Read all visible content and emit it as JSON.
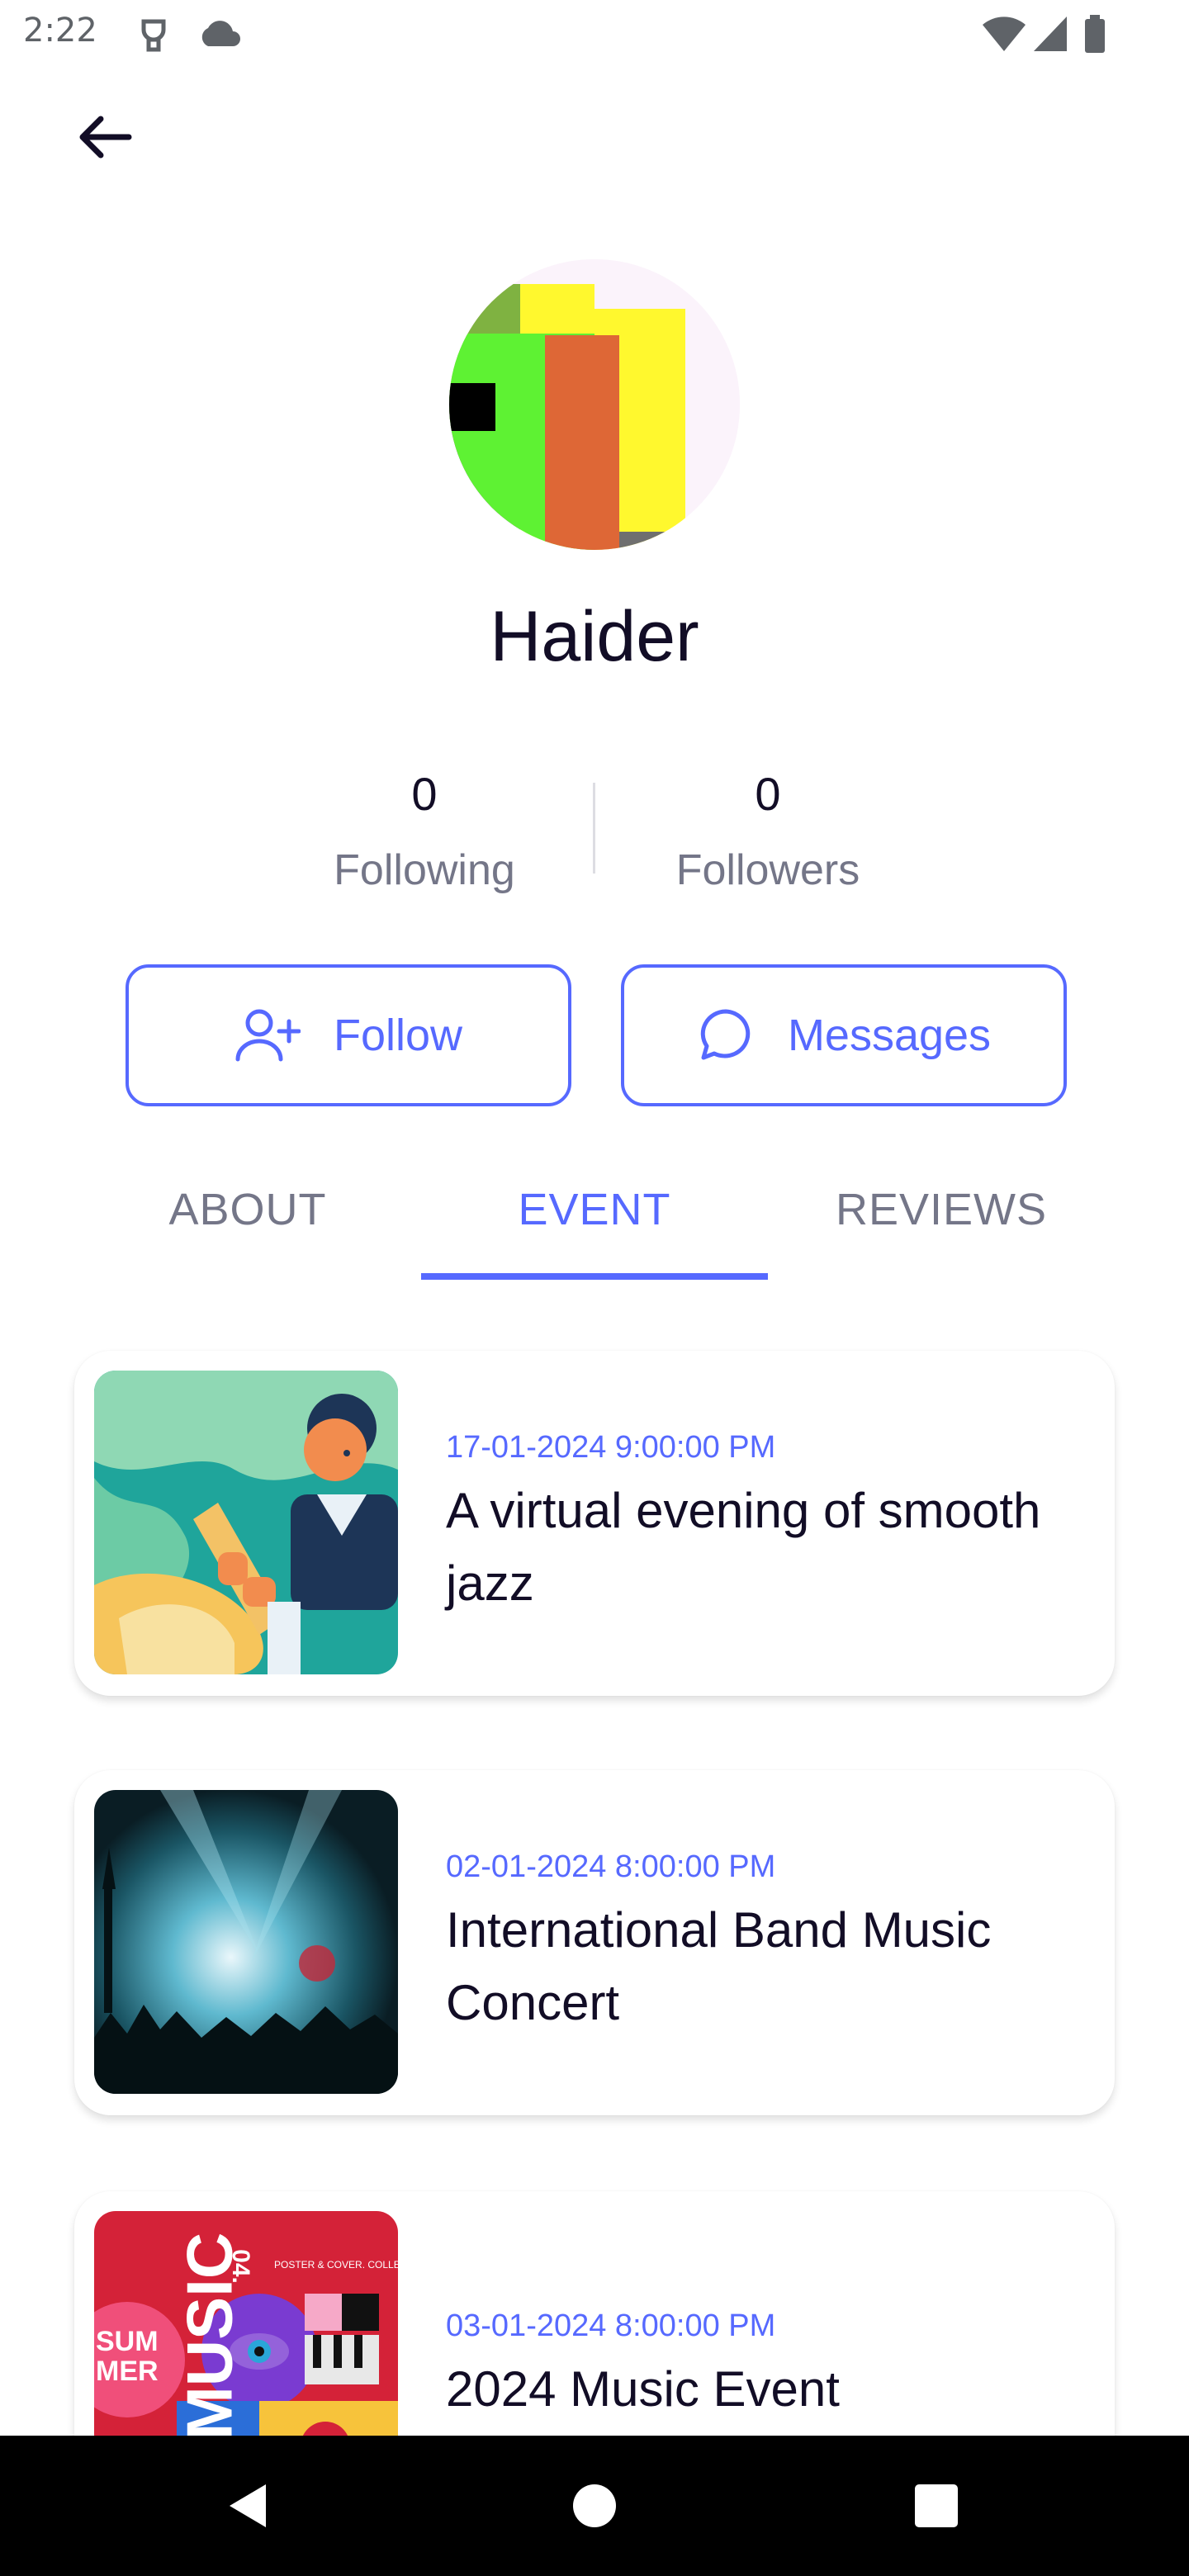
{
  "status_bar": {
    "time": "2:22"
  },
  "header": {
    "back_icon": "arrow-left-icon"
  },
  "profile": {
    "name": "Haider",
    "following_count": "0",
    "following_label": "Following",
    "followers_count": "0",
    "followers_label": "Followers"
  },
  "actions": {
    "follow_label": "Follow",
    "follow_icon": "add-user-icon",
    "messages_label": "Messages",
    "messages_icon": "chat-bubble-icon"
  },
  "tabs": [
    {
      "label": "ABOUT",
      "active": false
    },
    {
      "label": "EVENT",
      "active": true
    },
    {
      "label": "REVIEWS",
      "active": false
    }
  ],
  "events": [
    {
      "date": "17-01-2024 9:00:00 PM",
      "title": "A virtual evening of smooth jazz"
    },
    {
      "date": "02-01-2024 8:00:00 PM",
      "title": "International Band Music Concert"
    },
    {
      "date": "03-01-2024 8:00:00 PM",
      "title": "2024 Music Event",
      "poster_text_1": "SUM MER",
      "poster_text_2": "MUSIC",
      "poster_text_3": "04.",
      "poster_text_4": "POSTER & COVER. COLLECTION"
    }
  ],
  "colors": {
    "accent": "#5669ff",
    "text_primary": "#120d26",
    "text_secondary": "#747688"
  }
}
